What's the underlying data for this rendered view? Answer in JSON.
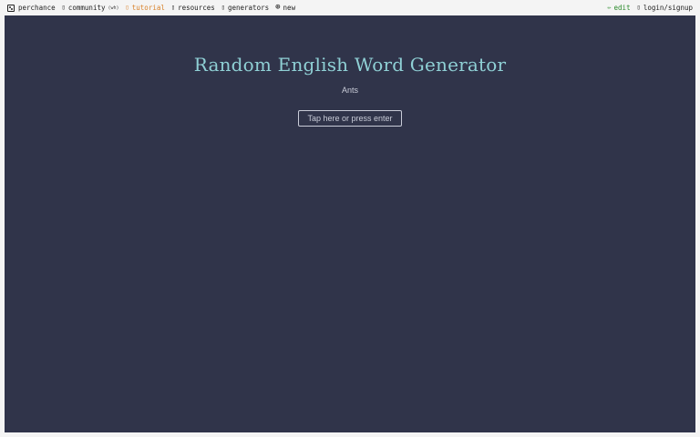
{
  "topbar": {
    "left": [
      {
        "label": "perchance",
        "icon": "dice-icon"
      },
      {
        "label": "community",
        "suffix": "(wh)",
        "icon": "chat-icon"
      },
      {
        "label": "tutorial",
        "icon": "book-icon"
      },
      {
        "label": "resources",
        "icon": "book-icon"
      },
      {
        "label": "generators",
        "icon": "sparkle-icon"
      },
      {
        "label": "new",
        "icon": "plus-circle-icon",
        "glyph": "⊕"
      }
    ],
    "right": [
      {
        "label": "edit",
        "icon": "pencil-icon",
        "glyph": "✏"
      },
      {
        "label": "login/signup",
        "icon": "user-icon"
      }
    ]
  },
  "main": {
    "title": "Random English Word Generator",
    "word": "Ants",
    "button_label": "Tap here or press enter"
  },
  "colors": {
    "background": "#30344a",
    "title": "#8fd0d5",
    "text": "#c9ccd8",
    "tutorial": "#d9822b",
    "edit": "#2a8a2a"
  }
}
